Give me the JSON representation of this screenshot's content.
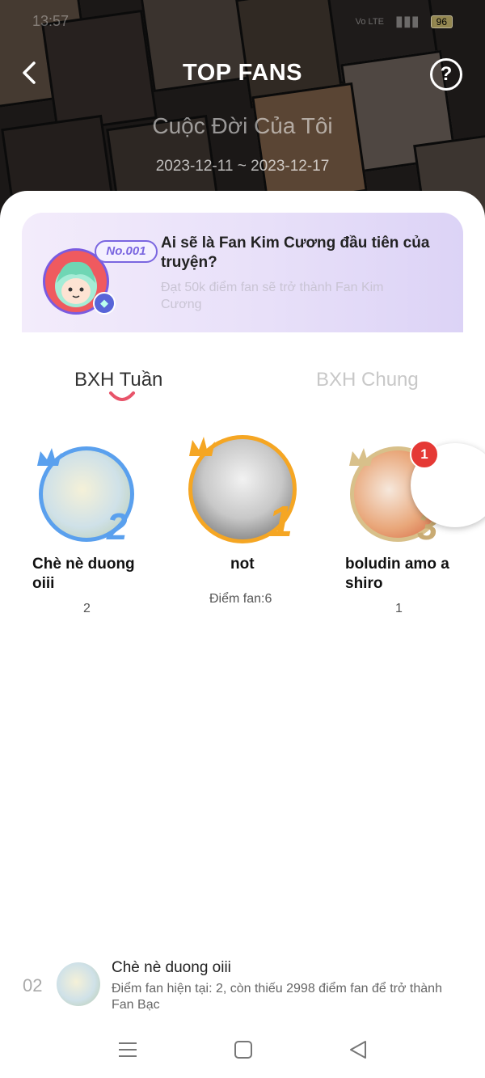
{
  "status_bar": {
    "time": "13:57",
    "network": "Vo LTE",
    "battery": "96"
  },
  "header": {
    "title": "TOP FANS",
    "help_label": "?",
    "story_title": "Cuộc Đời Của Tôi",
    "date_range": "2023-12-11 ~ 2023-12-17"
  },
  "promo": {
    "badge": "No.001",
    "heading": "Ai sẽ là Fan Kim Cương đầu tiên của truyện?",
    "subtext": "Đạt 50k điểm fan sẽ trở thành Fan Kim Cương"
  },
  "tabs": [
    {
      "label": "BXH Tuần",
      "active": true
    },
    {
      "label": "BXH Chung",
      "active": false
    }
  ],
  "podium": [
    {
      "rank": "2",
      "name": "Chè nè duong oiii",
      "score": "2",
      "ring_color": "#5aa0ee"
    },
    {
      "rank": "1",
      "name": "not",
      "score": "Điểm fan:6",
      "ring_color": "#f5a623"
    },
    {
      "rank": "3",
      "name": "boludin amo a shiro",
      "score": "1",
      "ring_color": "#d8c08a"
    }
  ],
  "notification_count": "1",
  "my_rank": {
    "rank": "02",
    "name": "Chè nè duong oiii",
    "info": "Điểm fan hiện tại: 2, còn thiếu 2998 điểm fan để trở thành Fan Bạc"
  },
  "colors": {
    "accent": "#e8546a",
    "promo_purple": "#7a66e0"
  }
}
